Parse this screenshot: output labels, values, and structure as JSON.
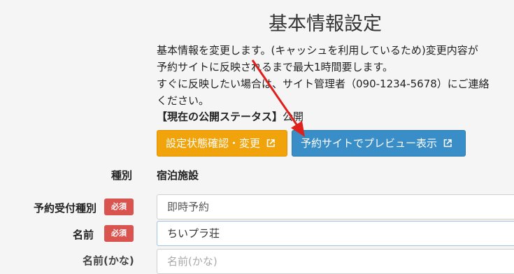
{
  "page": {
    "title": "基本情報設定",
    "description": [
      "基本情報を変更します。(キャッシュを利用しているため)変更内容が",
      "予約サイトに反映されるまで最大1時間要します。",
      "すぐに反映したい場合は、サイト管理者（090-1234-5678）にご連絡",
      "ください。"
    ],
    "status_label": "【現在の公開ステータス】",
    "status_value": "公開"
  },
  "buttons": {
    "confirm_label": "設定状態確認・変更",
    "preview_label": "予約サイトでプレビュー表示",
    "icon": "external-link-icon"
  },
  "form": {
    "type_label": "種別",
    "type_value": "宿泊施設",
    "reception_label": "予約受付種別",
    "reception_value": "即時予約",
    "name_label": "名前",
    "name_value": "ちいプラ荘",
    "required_badge": "必須",
    "next_label": "名前(かな)",
    "next_placeholder": "名前(かな)"
  },
  "annotation": {
    "arrow_color": "#e0201b"
  }
}
